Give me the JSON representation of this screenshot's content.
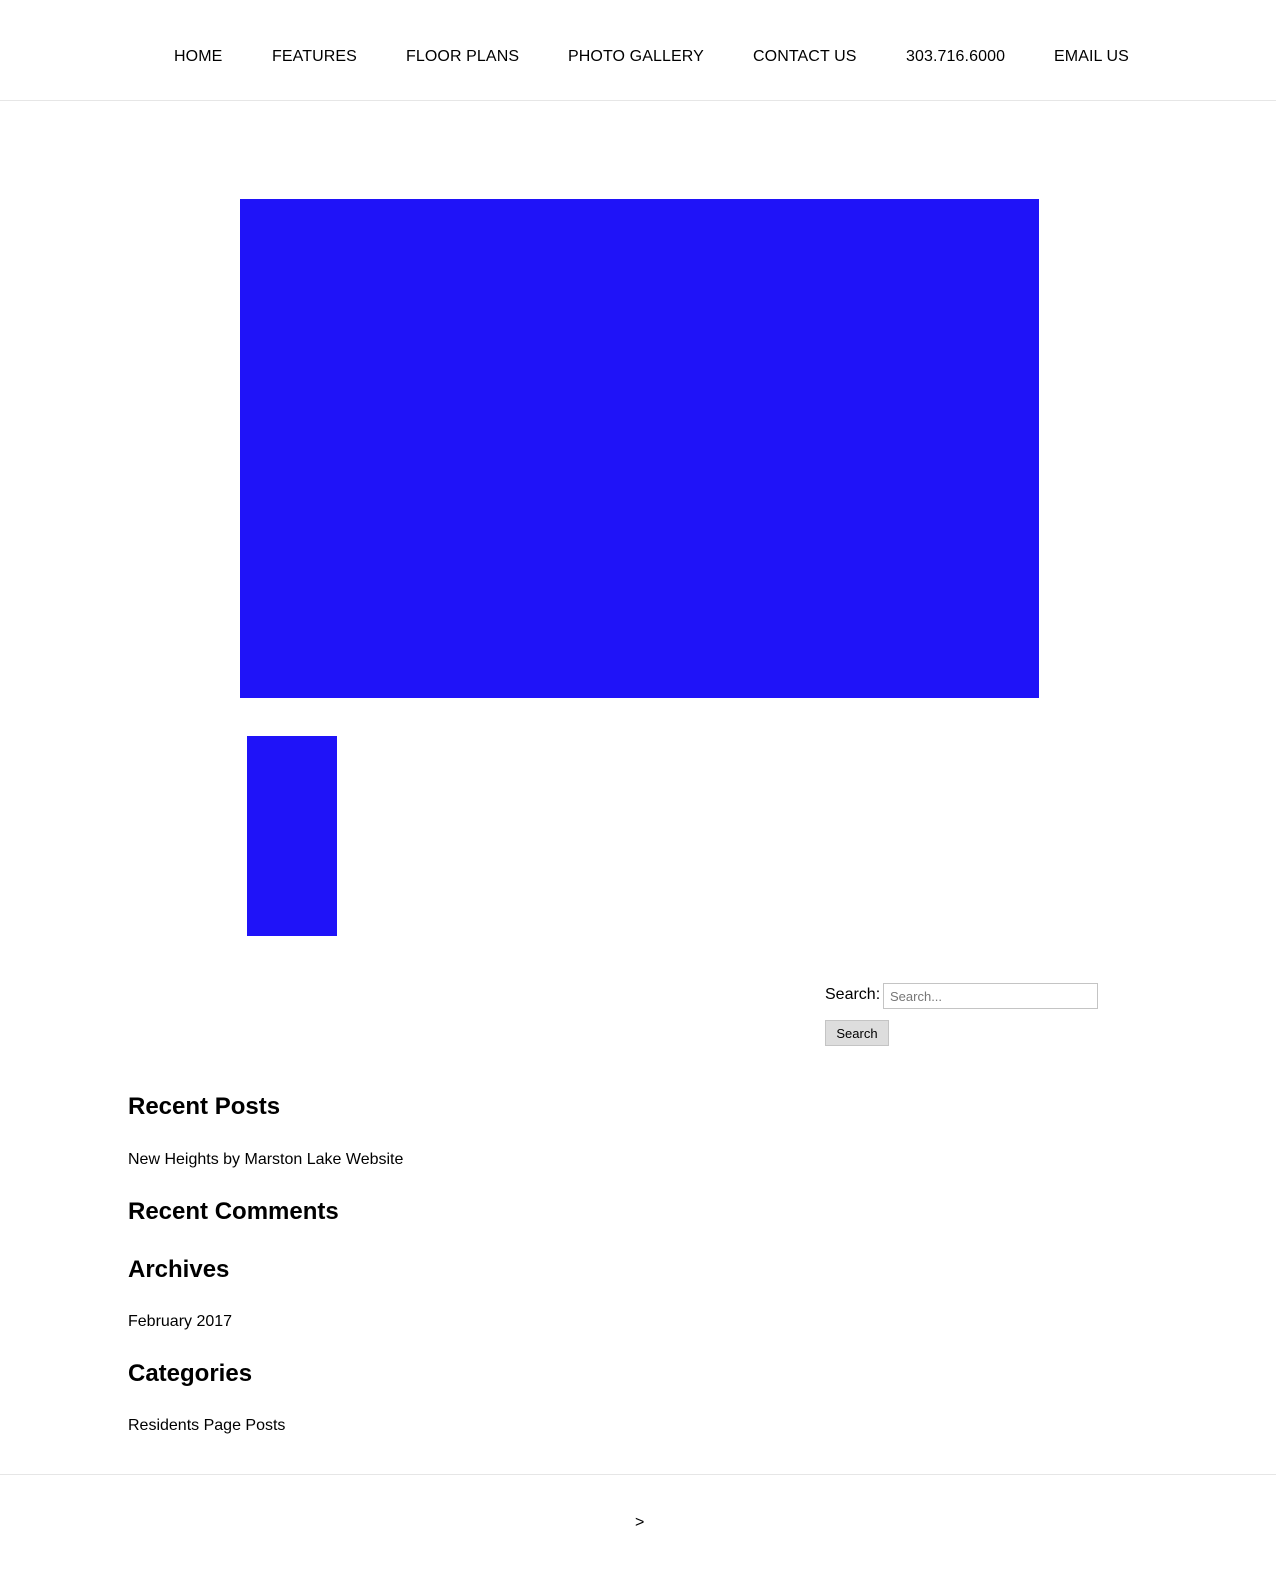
{
  "nav": {
    "items": [
      {
        "label": "HOME"
      },
      {
        "label": "FEATURES"
      },
      {
        "label": "FLOOR PLANS"
      },
      {
        "label": "PHOTO GALLERY"
      },
      {
        "label": "CONTACT US"
      },
      {
        "label": "303.716.6000"
      },
      {
        "label": "EMAIL US"
      }
    ]
  },
  "gallery": {
    "placeholder_color": "#1f13f8"
  },
  "search": {
    "label": "Search:",
    "placeholder": "Search...",
    "button_label": "Search"
  },
  "sidebar": {
    "recent_posts": {
      "title": "Recent Posts",
      "items": [
        "New Heights by Marston Lake Website"
      ]
    },
    "recent_comments": {
      "title": "Recent Comments"
    },
    "archives": {
      "title": "Archives",
      "items": [
        "February 2017"
      ]
    },
    "categories": {
      "title": "Categories",
      "items": [
        "Residents Page Posts"
      ]
    }
  },
  "footer": {
    "text": ">"
  }
}
